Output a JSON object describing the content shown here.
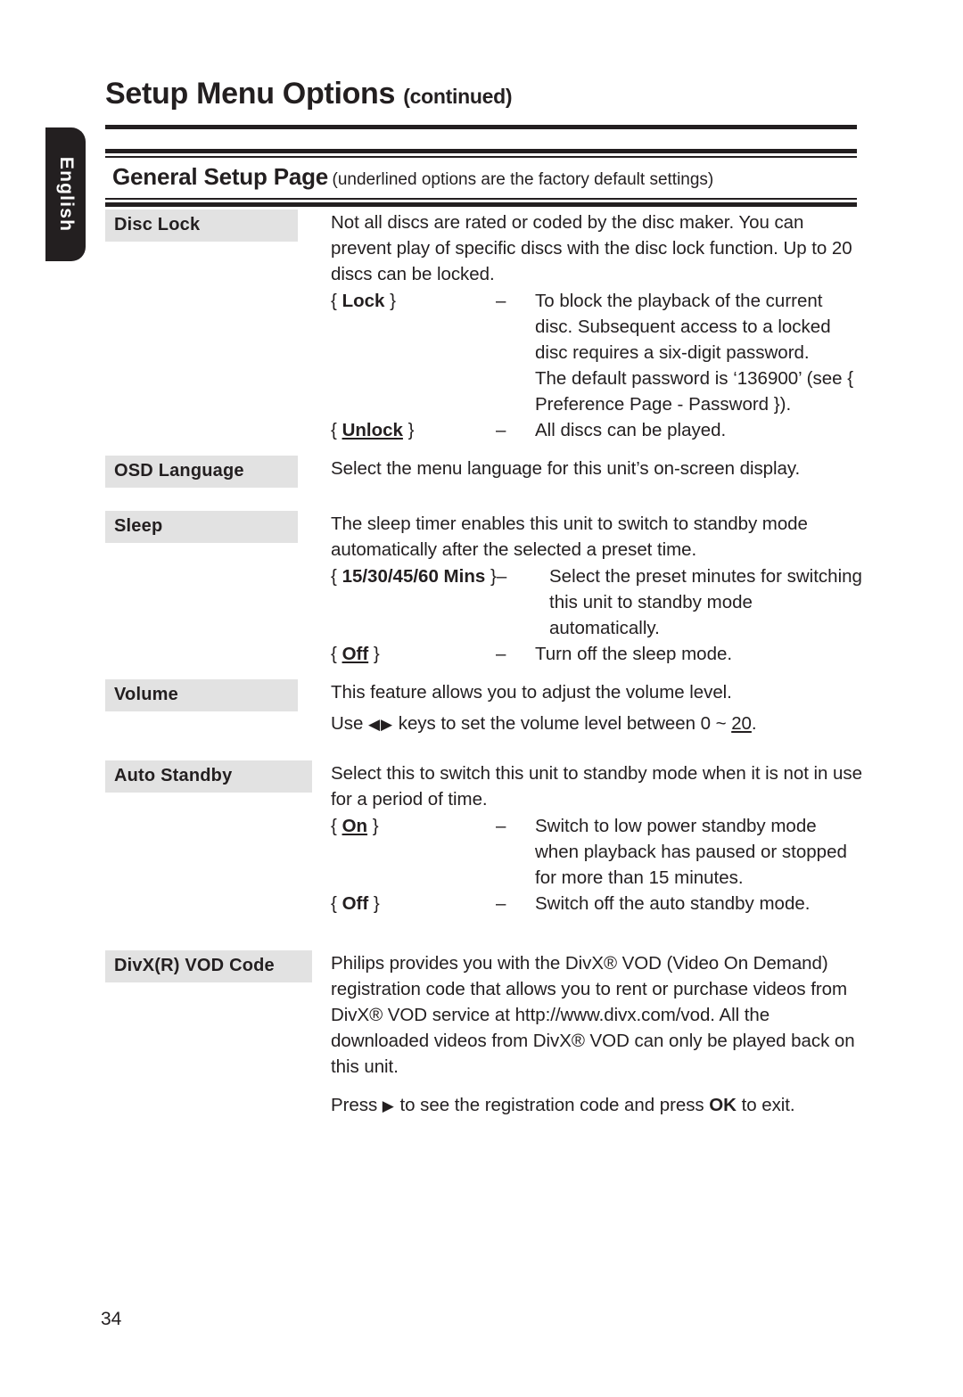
{
  "language_tab": {
    "label": "English"
  },
  "header": {
    "title_main": "Setup Menu Options",
    "title_continued": "(continued)"
  },
  "section": {
    "band_title": "General Setup Page",
    "band_subtitle": "(underlined options are the factory default settings)"
  },
  "entries": [
    {
      "label": "Disc Lock",
      "intro": "Not all discs are rated or coded by the disc maker. You can prevent play of specific discs with the disc lock function. Up to 20 discs can be locked.",
      "options": [
        {
          "open": "{",
          "name": "Lock",
          "close": "}",
          "underlined": false,
          "dash": "–",
          "desc": "To block the playback of the current disc. Subsequent access to a locked disc requires a six-digit password.",
          "desc2": "The default password is ‘136900’ (see { Preference Page - Password })."
        },
        {
          "open": "{",
          "name": "Unlock",
          "close": "}",
          "underlined": true,
          "dash": "–",
          "desc": "All discs can be played."
        }
      ]
    },
    {
      "label": "OSD Language",
      "intro": "Select the menu language for this unit’s on-screen display.",
      "options": []
    },
    {
      "label": "Sleep",
      "intro": "The sleep timer enables this unit to switch to standby mode automatically after the selected a preset time.",
      "options": [
        {
          "open": "{",
          "name": "15/30/45/60 Mins",
          "close": "}",
          "underlined": false,
          "dash": "–",
          "desc": "Select the preset minutes for switching this unit to standby mode automatically."
        },
        {
          "open": "{",
          "name": "Off",
          "close": "}",
          "underlined": true,
          "dash": "–",
          "desc": "Turn off the sleep mode."
        }
      ]
    },
    {
      "label": "Volume",
      "intro": "This feature allows you to adjust the volume level.",
      "intro2_pre": "Use ",
      "intro2_arrows": "◀▶",
      "intro2_mid": " keys to set the volume level between 0 ~ ",
      "intro2_underlined": "20",
      "intro2_post": ".",
      "options": []
    },
    {
      "label": "Auto Standby",
      "intro": "Select this to switch this unit to standby mode when it is not in use for a period of time.",
      "options": [
        {
          "open": "{",
          "name": "On",
          "close": "}",
          "underlined": true,
          "dash": "–",
          "desc": "Switch to low power standby mode when playback has paused or stopped for more than 15 minutes."
        },
        {
          "open": "{",
          "name": "Off",
          "close": "}",
          "underlined": false,
          "dash": "–",
          "desc": "Switch off the auto standby mode."
        }
      ]
    },
    {
      "label": "DivX(R) VOD Code",
      "intro": "Philips provides you with the DivX® VOD (Video On Demand) registration code that allows you to rent or purchase videos from DivX® VOD service at http://www.divx.com/vod. All the downloaded videos from DivX® VOD can only be played back on this unit.",
      "intro2_pre": "Press ",
      "intro2_arrows": "▶",
      "intro2_mid": " to see the registration code and press ",
      "intro2_bold": "OK",
      "intro2_post": " to exit.",
      "options": []
    }
  ],
  "footer": {
    "page_number": "34"
  }
}
